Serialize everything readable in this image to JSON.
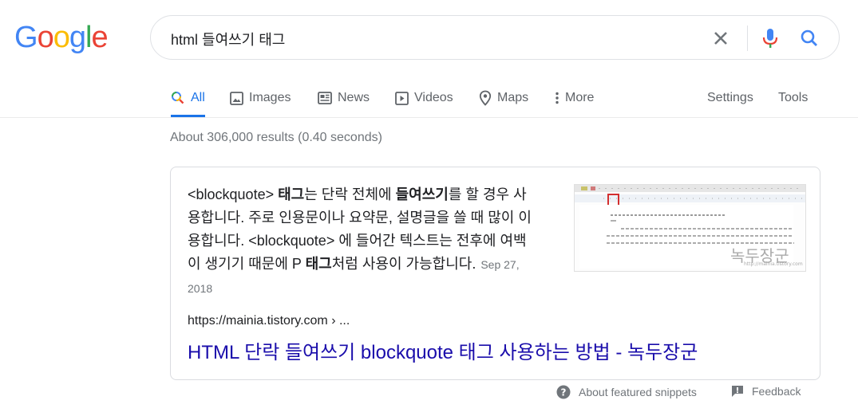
{
  "logo": {
    "letters": [
      "G",
      "o",
      "o",
      "g",
      "l",
      "e"
    ],
    "colors": [
      "#4285F4",
      "#EA4335",
      "#FBBC05",
      "#4285F4",
      "#34A853",
      "#EA4335"
    ]
  },
  "search": {
    "query": "html 들여쓰기 태그"
  },
  "tabs": [
    {
      "label": "All",
      "icon": "search-icon",
      "active": true
    },
    {
      "label": "Images",
      "icon": "image-icon"
    },
    {
      "label": "News",
      "icon": "news-icon"
    },
    {
      "label": "Videos",
      "icon": "play-icon"
    },
    {
      "label": "Maps",
      "icon": "map-pin-icon"
    },
    {
      "label": "More",
      "icon": "more-vertical-icon"
    },
    {
      "label": "Settings"
    },
    {
      "label": "Tools"
    }
  ],
  "stats": "About 306,000 results (0.40 seconds)",
  "snippet": {
    "segments": [
      {
        "t": "<blockquote> "
      },
      {
        "t": "태그",
        "b": true
      },
      {
        "t": "는 단락 전체에 "
      },
      {
        "t": "들여쓰기",
        "b": true
      },
      {
        "t": "를 할 경우 사용합니다. 주로 인용문이나 요약문, 설명글을 쓸 때 많이 이용합니다. <blockquote> 에 들어간 텍스트는 전후에 여백이 생기기 때문에 P "
      },
      {
        "t": "태그",
        "b": true
      },
      {
        "t": "처럼 사용이 가능합니다."
      }
    ],
    "date": "Sep 27, 2018",
    "url": "https://mainia.tistory.com › ...",
    "title": "HTML 단락 들여쓰기 blockquote 태그 사용하는 방법 - 녹두장군"
  },
  "footer": {
    "about": "About featured snippets",
    "feedback": "Feedback"
  }
}
